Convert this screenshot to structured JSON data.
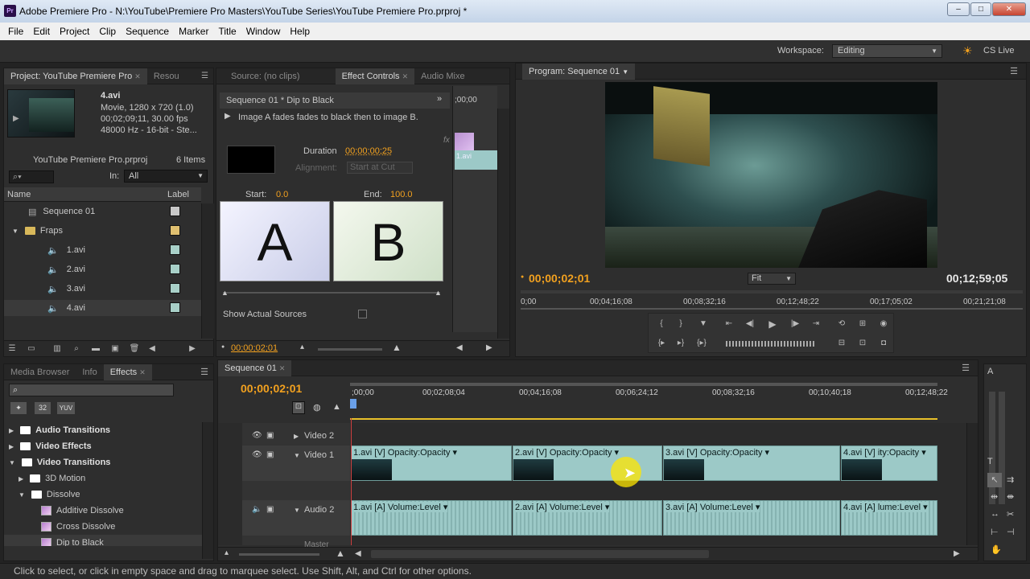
{
  "window": {
    "title": "Adobe Premiere Pro - N:\\YouTube\\Premiere Pro Masters\\YouTube Series\\YouTube Premiere Pro.prproj *",
    "app_icon": "Pr"
  },
  "menu": [
    "File",
    "Edit",
    "Project",
    "Clip",
    "Sequence",
    "Marker",
    "Title",
    "Window",
    "Help"
  ],
  "toolbar": {
    "workspace_label": "Workspace:",
    "workspace_value": "Editing",
    "cs_live": "CS Live"
  },
  "project": {
    "tab": "Project: YouTube Premiere Pro",
    "tab2": "Resou",
    "clip_name": "4.avi",
    "clip_info1": "Movie, 1280 x 720 (1.0)",
    "clip_info2": "00;02;09;11, 30.00 fps",
    "clip_info3": "48000 Hz - 16-bit - Ste...",
    "file": "YouTube Premiere Pro.prproj",
    "count": "6 Items",
    "in_label": "In:",
    "in_value": "All",
    "col_name": "Name",
    "col_label": "Label",
    "items": [
      {
        "name": "Sequence 01",
        "color": "#c8c8c8"
      },
      {
        "name": "Fraps",
        "color": "#e0c070"
      },
      {
        "name": "1.avi",
        "color": "#a8d0c8"
      },
      {
        "name": "2.avi",
        "color": "#a8d0c8"
      },
      {
        "name": "3.avi",
        "color": "#a8d0c8"
      },
      {
        "name": "4.avi",
        "color": "#a8d0c8"
      }
    ]
  },
  "effect_controls": {
    "tabs": [
      "Source: (no clips)",
      "Effect Controls",
      "Audio Mixe"
    ],
    "header": "Sequence 01 * Dip to Black",
    "description": "Image A fades fades to black then to image B.",
    "duration_label": "Duration",
    "duration_value": "00;00;00;25",
    "alignment_label": "Alignment:",
    "alignment_value": "Start at Cut",
    "start_label": "Start:",
    "start_value": "0.0",
    "end_label": "End:",
    "end_value": "100.0",
    "a_letter": "A",
    "b_letter": "B",
    "show_actual": "Show Actual Sources",
    "time": "00;00;02;01",
    "mini_time": ";00;00",
    "mini_clip": "1.avi",
    "fx": "fx"
  },
  "program": {
    "tab": "Program: Sequence 01",
    "time": "00;00;02;01",
    "duration": "00;12;59;05",
    "fit": "Fit",
    "ruler": [
      "0;00",
      "00;04;16;08",
      "00;08;32;16",
      "00;12;48;22",
      "00;17;05;02",
      "00;21;21;08"
    ]
  },
  "effects": {
    "tabs": [
      "Media Browser",
      "Info",
      "Effects"
    ],
    "badges": [
      "32",
      "YUV"
    ],
    "items": [
      {
        "label": "Audio Transitions",
        "level": 0,
        "type": "folder",
        "open": false
      },
      {
        "label": "Video Effects",
        "level": 0,
        "type": "folder",
        "open": false
      },
      {
        "label": "Video Transitions",
        "level": 0,
        "type": "folder",
        "open": true
      },
      {
        "label": "3D Motion",
        "level": 1,
        "type": "folder",
        "open": false
      },
      {
        "label": "Dissolve",
        "level": 1,
        "type": "folder",
        "open": true
      },
      {
        "label": "Additive Dissolve",
        "level": 2,
        "type": "effect"
      },
      {
        "label": "Cross Dissolve",
        "level": 2,
        "type": "effect"
      },
      {
        "label": "Dip to Black",
        "level": 2,
        "type": "effect"
      }
    ]
  },
  "timeline": {
    "tab": "Sequence 01",
    "time": "00;00;02;01",
    "ruler": [
      ";00;00",
      "00;02;08;04",
      "00;04;16;08",
      "00;06;24;12",
      "00;08;32;16",
      "00;10;40;18",
      "00;12;48;22"
    ],
    "tracks": {
      "video2": "Video 2",
      "video1": "Video 1",
      "audio2": "Audio 2",
      "master": "Master"
    },
    "video_clips": [
      {
        "name": "1.avi [V]",
        "fx": "Opacity:Opacity"
      },
      {
        "name": "2.avi [V]",
        "fx": "Opacity:Opacity"
      },
      {
        "name": "3.avi [V]",
        "fx": "Opacity:Opacity"
      },
      {
        "name": "4.avi [V]",
        "fx": "ity:Opacity"
      }
    ],
    "audio_clips": [
      {
        "name": "1.avi [A]",
        "fx": "Volume:Level"
      },
      {
        "name": "2.avi [A]",
        "fx": "Volume:Level"
      },
      {
        "name": "3.avi [A]",
        "fx": "Volume:Level"
      },
      {
        "name": "4.avi [A]",
        "fx": "lume:Level"
      }
    ]
  },
  "tools": {
    "tab": "A",
    "tab2": "T"
  },
  "status": "Click to select, or click in empty space and drag to marquee select. Use Shift, Alt, and Ctrl for other options."
}
